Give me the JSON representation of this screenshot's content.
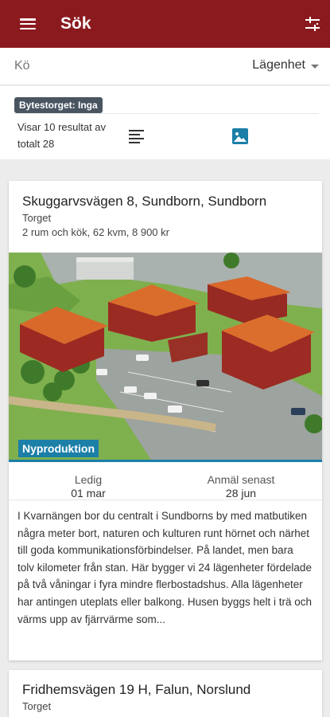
{
  "appbar": {
    "title": "Sök",
    "menu_icon": "hamburger-menu-icon",
    "filter_icon": "filter-sliders-icon",
    "color": "#8b1a1f"
  },
  "search": {
    "queue_placeholder": "Kö",
    "type_selected": "Lägenhet"
  },
  "info": {
    "bytestorget_badge": "Bytestorget: Inga",
    "result_count": "Visar 10 resultat av totalt 28",
    "list_view_icon": "list-view-icon",
    "image_view_icon": "image-view-icon"
  },
  "listings": [
    {
      "address": "Skuggarvsvägen 8, Sundborn, Sundborn",
      "area": "Torget",
      "summary": "2 rum och kök, 62 kvm, 8 900 kr",
      "badge": "Nyproduktion",
      "available_label": "Ledig",
      "available_date": "01 mar",
      "deadline_label": "Anmäl senast",
      "deadline_date": "28 jun",
      "description": "I Kvarnängen bor du centralt i Sundborns by med matbutiken några meter bort, naturen och kulturen runt hörnet och närhet till goda kommunikationsförbindelser. På landet, men bara tolv kilometer från stan.  Här bygger vi 24 lägenheter fördelade på två våningar i fyra mindre flerbostadshus. Alla lägenheter har antingen uteplats eller balkong. Husen byggs helt i trä och värms upp av fjärrvärme som..."
    },
    {
      "address": "Fridhemsvägen 19 H, Falun, Norslund",
      "area": "Torget"
    }
  ],
  "colors": {
    "accent": "#1b7fa8",
    "badge_dark": "#4a5562"
  }
}
